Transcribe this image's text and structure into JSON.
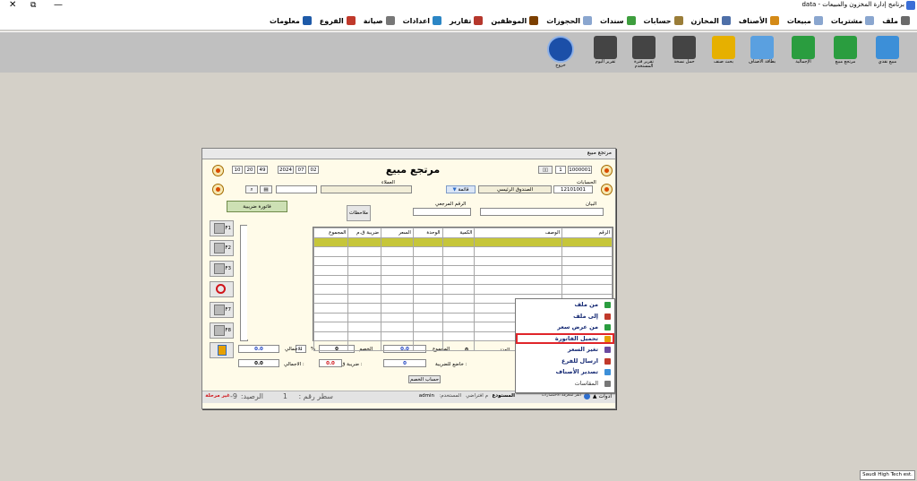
{
  "window": {
    "title": "برنامج إدارة المخزون والمبيعات - data",
    "close_glyph": "✕",
    "restore_glyph": "⧉",
    "minimize_glyph": "—"
  },
  "menu": [
    {
      "label": "ملف",
      "icon": "file-icon",
      "color": "#6a6a6a"
    },
    {
      "label": "مشتريات",
      "icon": "document-icon",
      "color": "#8aa6cf"
    },
    {
      "label": "مبيعات",
      "icon": "document-icon",
      "color": "#8aa6cf"
    },
    {
      "label": "الأصناف",
      "icon": "box-icon",
      "color": "#d48a17"
    },
    {
      "label": "المخازن",
      "icon": "warehouse-icon",
      "color": "#4e6fa8"
    },
    {
      "label": "حسابات",
      "icon": "coins-icon",
      "color": "#9a7d38"
    },
    {
      "label": "سندات",
      "icon": "voucher-icon",
      "color": "#3e9e3e"
    },
    {
      "label": "الحجوزات",
      "icon": "pages-icon",
      "color": "#8aa6cf"
    },
    {
      "label": "الموظفين",
      "icon": "person-icon",
      "color": "#7b3f00"
    },
    {
      "label": "تقارير",
      "icon": "report-icon",
      "color": "#b5372c"
    },
    {
      "label": "اعدادات",
      "icon": "settings-icon",
      "color": "#2b86c5"
    },
    {
      "label": "صيانة",
      "icon": "tools-icon",
      "color": "#777777"
    },
    {
      "label": "الفروع",
      "icon": "shop-icon",
      "color": "#c0392b"
    },
    {
      "label": "معلومات",
      "icon": "info-icon",
      "color": "#1e5aa8"
    }
  ],
  "toolbar": [
    {
      "label": "مبيع نقدي",
      "icon": "cash-sale-icon",
      "color": "#3c8fd8"
    },
    {
      "label": "مرتجع مبيع",
      "icon": "sales-return-icon",
      "color": "#2a9d3f"
    },
    {
      "label": "الإجمالية",
      "icon": "total-icon",
      "color": "#2a9d3f"
    },
    {
      "label": "بطاقة الأصناف",
      "icon": "item-card-icon",
      "color": "#5aa0e0"
    },
    {
      "label": "بحث صنف",
      "icon": "search-item-icon",
      "color": "#e6b000"
    },
    {
      "label": "حمل نسخة",
      "icon": "backup-icon",
      "color": "#444444"
    },
    {
      "label": "تقرير فترة المستخدم",
      "icon": "printer-report-icon",
      "color": "#444444"
    },
    {
      "label": "تقرير اليوم",
      "icon": "printer-icon",
      "color": "#444444"
    },
    {
      "label": "خروج",
      "icon": "lock-icon",
      "color": "#1b4fa8"
    }
  ],
  "workspace": {
    "company": "Saudi High Tech est."
  },
  "dialog": {
    "title": "مرتجع مبيع",
    "heading": "مرتجع مبيع",
    "invoice_no": "1000001",
    "copies": "1",
    "date": {
      "day": "02",
      "month": "07",
      "year": "2024"
    },
    "time": {
      "h": "10",
      "m": "20",
      "s": "49"
    },
    "account_label": "الحسابات",
    "account_code": "12101001",
    "account_name": "الصندوق الرئيسي",
    "customer_label": "العملاء",
    "list_label": "قائمة",
    "statement_label": "البيان",
    "ref_label": "الرقم المرجعي",
    "notes_button": "ملاحظات",
    "tax_invoice_button": "فاتورة ضريبية",
    "side_buttons": [
      "F1",
      "F2",
      "F3",
      "",
      "F7",
      "F8"
    ],
    "columns": [
      "الرقم",
      "الوصف",
      "الكمية",
      "الوحدة",
      "السعر",
      "ضريبة ق.م",
      "المجموع"
    ],
    "row_count": 12,
    "totals": {
      "count_label": "العدد",
      "count": "0",
      "sum_label": "المجموع",
      "sum": "0.0",
      "discount_label": "الخصم",
      "discount": "0",
      "percent_sign": "%",
      "total_label": "الاجمالي",
      "total": "0.0",
      "taxable_label": "خاضع للضريبة :",
      "taxable": "0",
      "vat_label": "ضريبة ق.م :",
      "vat": "0.0",
      "total2_label": "الاجمالي :",
      "total2": "0.0"
    },
    "discount_calc_button": "حساب الخصم",
    "status": {
      "tools": "أدوات",
      "shortcuts": "انقر لمعرفة الاختصارات",
      "warehouse_label": "المستودع",
      "warehouse": "م افتراضي",
      "user_label": "المستخدم:",
      "user": "admin",
      "line_label": "سطر رقم :",
      "line": "1",
      "balance_label": "الرصيد:",
      "balance": "9-",
      "unposted": "غير مرحلة"
    }
  },
  "popup": [
    {
      "label": "من ملف",
      "icon": "import-file-icon",
      "color": "#2a9d3f",
      "highlight": false
    },
    {
      "label": "إلى ملف",
      "icon": "export-file-icon",
      "color": "#c0392b",
      "highlight": false
    },
    {
      "label": "من عرض سعر",
      "icon": "quote-icon",
      "color": "#2a9d3f",
      "highlight": false
    },
    {
      "label": "تحميل الفاتورة",
      "icon": "load-invoice-icon",
      "color": "#e6a000",
      "highlight": true
    },
    {
      "label": "تغير السعر",
      "icon": "price-icon",
      "color": "#6b4aa0",
      "highlight": false
    },
    {
      "label": "ارسال للفرع",
      "icon": "send-branch-icon",
      "color": "#c0392b",
      "highlight": false
    },
    {
      "label": "تصدير الأصناف",
      "icon": "export-items-icon",
      "color": "#3c8fd8",
      "highlight": false
    },
    {
      "label": "المقاسات",
      "icon": "sizes-icon",
      "color": "#777777",
      "highlight": false
    }
  ]
}
